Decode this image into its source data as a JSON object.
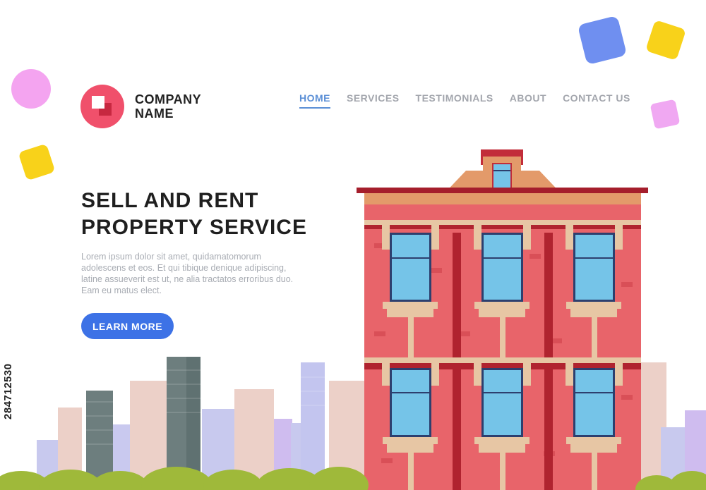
{
  "brand": {
    "line1": "COMPANY",
    "line2": "NAME"
  },
  "nav": {
    "items": [
      {
        "label": "HOME",
        "active": true
      },
      {
        "label": "SERVICES",
        "active": false
      },
      {
        "label": "TESTIMONIALS",
        "active": false
      },
      {
        "label": "ABOUT",
        "active": false
      },
      {
        "label": "CONTACT US",
        "active": false
      }
    ]
  },
  "hero": {
    "title_line1": "SELL AND RENT",
    "title_line2": "PROPERTY SERVICE",
    "body": "Lorem ipsum dolor sit amet, quidamatomorum adolescens et eos. Et qui tibique denique adipiscing, latine assueverit est ut, ne alia tractatos erroribus duo. Eam eu matus elect.",
    "cta_label": "LEARN MORE"
  },
  "watermark": {
    "id": "284712530"
  },
  "colors": {
    "accent": "#3d72e6",
    "nav_active": "#5b8fd6",
    "brand_red": "#f0506b",
    "building_wall": "#e8646a",
    "bush": "#9fb93a"
  },
  "icons": {
    "logo": "overlapping-squares-logo-icon"
  }
}
